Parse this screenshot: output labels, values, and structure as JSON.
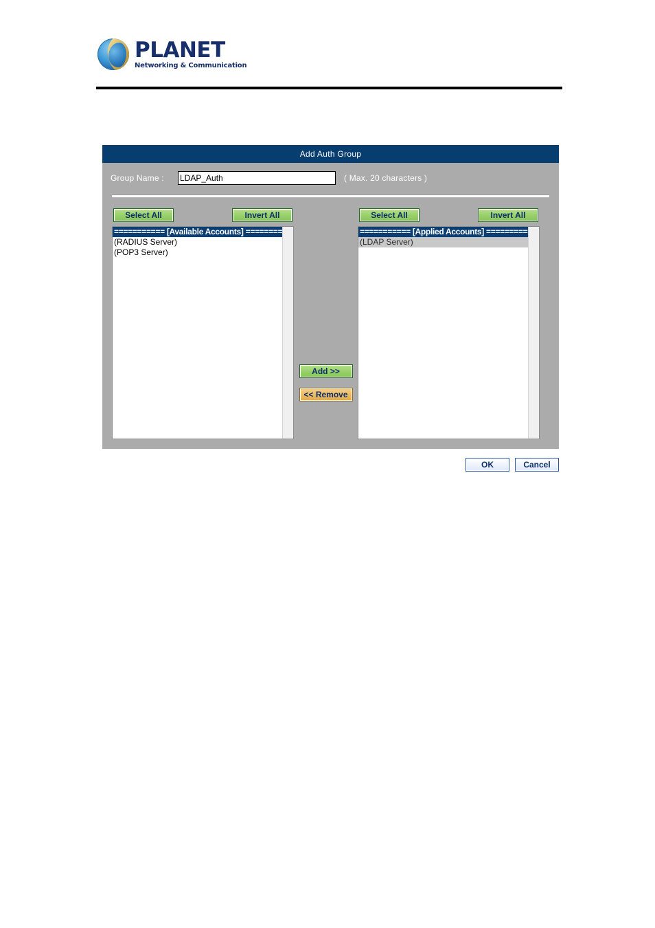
{
  "brand": {
    "name": "PLANET",
    "tagline": "Networking & Communication",
    "logo_icon": "planet-globe-icon",
    "text_color": "#17306b"
  },
  "dialog": {
    "title": "Add Auth Group",
    "accent_color": "#083d70",
    "panel_color": "#ababab",
    "group_name": {
      "label": "Group Name :",
      "value": "LDAP_Auth",
      "placeholder": "",
      "hint": "( Max. 20 characters )"
    },
    "available": {
      "select_all_label": "Select All",
      "invert_all_label": "Invert All",
      "items": [
        {
          "text": "=========== [Available Accounts] ==========",
          "state": "separator"
        },
        {
          "text": "(RADIUS Server)",
          "state": "normal"
        },
        {
          "text": "(POP3 Server)",
          "state": "normal"
        }
      ]
    },
    "applied": {
      "select_all_label": "Select All",
      "invert_all_label": "Invert All",
      "items": [
        {
          "text": "=========== [Applied Accounts] ===========",
          "state": "separator"
        },
        {
          "text": "(LDAP Server)",
          "state": "selected"
        }
      ]
    },
    "transfer": {
      "add_label": "Add >>",
      "remove_label": "<< Remove",
      "add_color": "#97cf6a",
      "remove_color": "#eab963"
    },
    "footer": {
      "ok_label": "OK",
      "cancel_label": "Cancel"
    }
  }
}
